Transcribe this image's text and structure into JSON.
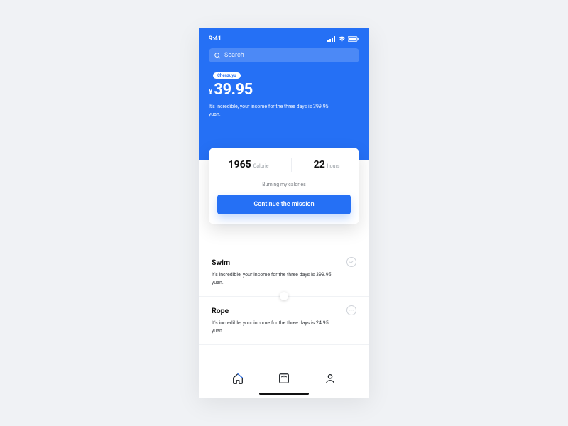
{
  "status": {
    "time": "9:41"
  },
  "search": {
    "placeholder": "Search"
  },
  "user": {
    "name_badge": "Chenzuyu"
  },
  "balance": {
    "currency": "¥",
    "amount": "39.95",
    "subtitle": "It's incredible, your income for the three days is 399.95 yuan."
  },
  "stats": {
    "calories": {
      "value": "1965",
      "label": "Calorie"
    },
    "hours": {
      "value": "22",
      "label": "hours"
    },
    "caption": "Burning my calories",
    "cta": "Continue the mission"
  },
  "activities": [
    {
      "title": "Swim",
      "desc": "It's incredible, your income for the three days is 399.95 yuan.",
      "icon": "check"
    },
    {
      "title": "Rope",
      "desc": "It's incredible, your income for the three days is 24.95 yuan.",
      "icon": "more"
    }
  ]
}
